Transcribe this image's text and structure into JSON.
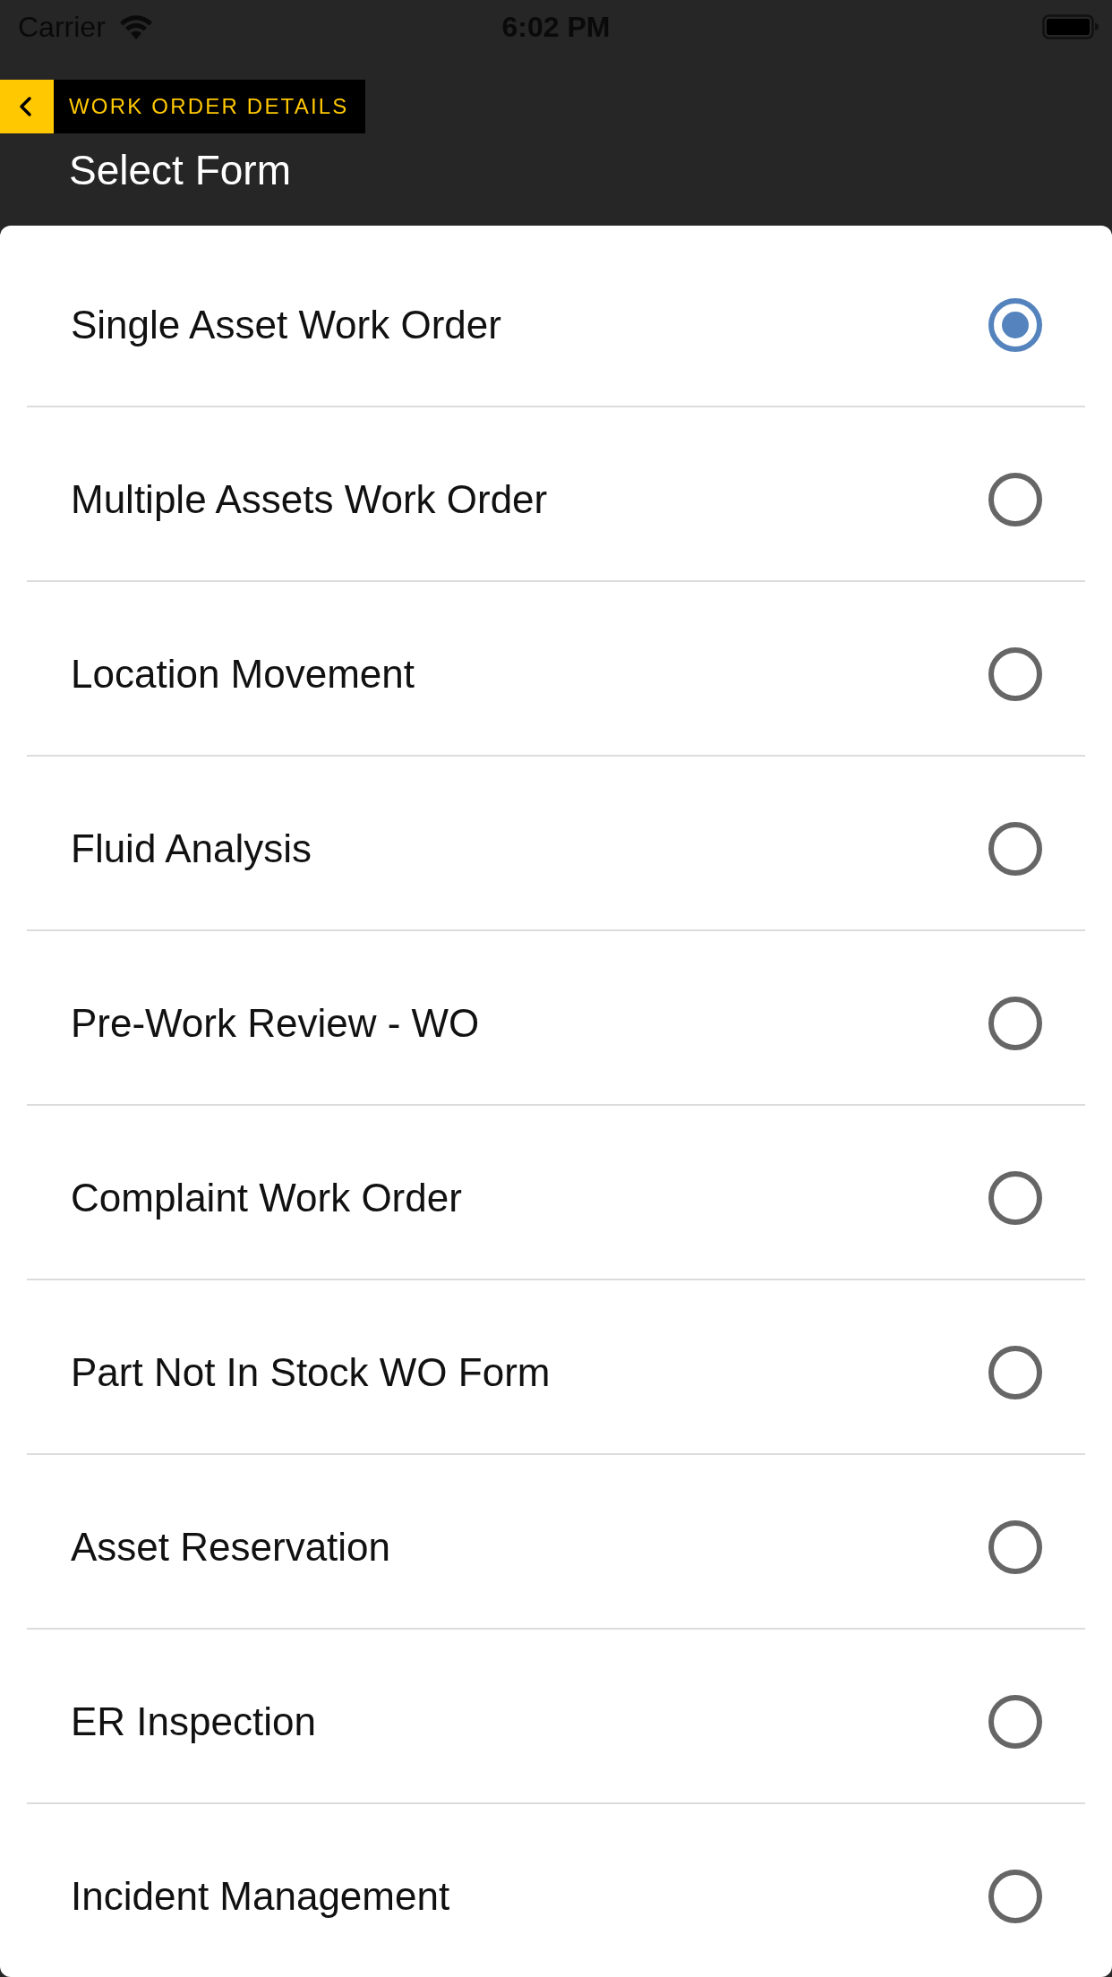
{
  "status_bar": {
    "carrier": "Carrier",
    "time": "6:02 PM"
  },
  "nav": {
    "back_label": "WORK ORDER DETAILS",
    "title": "Select Form"
  },
  "forms": [
    {
      "label": "Single Asset Work Order",
      "selected": true
    },
    {
      "label": "Multiple Assets Work Order",
      "selected": false
    },
    {
      "label": "Location Movement",
      "selected": false
    },
    {
      "label": "Fluid Analysis",
      "selected": false
    },
    {
      "label": "Pre-Work Review - WO",
      "selected": false
    },
    {
      "label": "Complaint Work Order",
      "selected": false
    },
    {
      "label": "Part Not In Stock WO Form",
      "selected": false
    },
    {
      "label": "Asset Reservation",
      "selected": false
    },
    {
      "label": "ER Inspection",
      "selected": false
    },
    {
      "label": "Incident Management",
      "selected": false
    }
  ]
}
